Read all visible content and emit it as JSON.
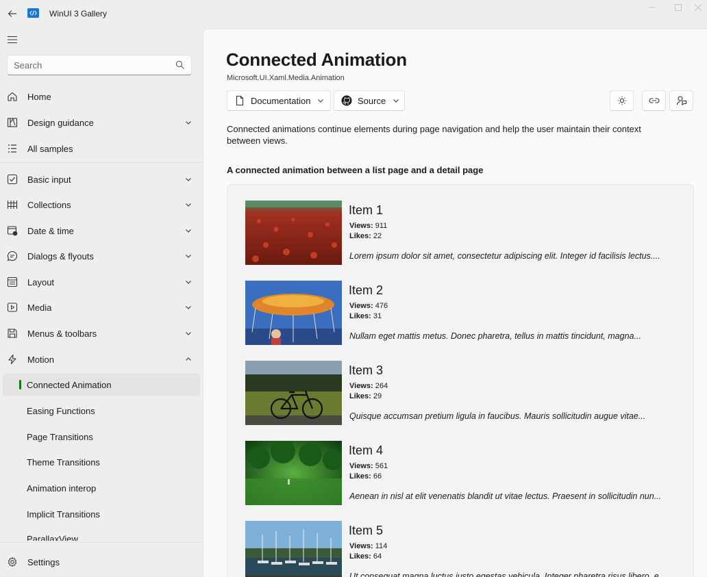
{
  "window": {
    "title": "WinUI 3 Gallery"
  },
  "search": {
    "placeholder": "Search"
  },
  "nav": {
    "top_items": [
      {
        "label": "Home",
        "icon": "home-icon"
      },
      {
        "label": "Design guidance",
        "icon": "design-guidance-icon"
      },
      {
        "label": "All samples",
        "icon": "list-icon"
      }
    ],
    "categories": [
      {
        "label": "Basic input",
        "icon": "checkbox-icon"
      },
      {
        "label": "Collections",
        "icon": "grid-icon"
      },
      {
        "label": "Date & time",
        "icon": "calendar-clock-icon"
      },
      {
        "label": "Dialogs & flyouts",
        "icon": "chat-icon"
      },
      {
        "label": "Layout",
        "icon": "layout-icon"
      },
      {
        "label": "Media",
        "icon": "media-icon"
      },
      {
        "label": "Menus & toolbars",
        "icon": "save-icon"
      },
      {
        "label": "Motion",
        "icon": "motion-icon"
      }
    ],
    "motion_children": [
      {
        "label": "Connected Animation",
        "selected": true
      },
      {
        "label": "Easing Functions"
      },
      {
        "label": "Page Transitions"
      },
      {
        "label": "Theme Transitions"
      },
      {
        "label": "Animation interop"
      },
      {
        "label": "Implicit Transitions"
      },
      {
        "label": "ParallaxView"
      }
    ],
    "settings_label": "Settings",
    "accent_color": "#0f7b0f"
  },
  "page": {
    "title": "Connected Animation",
    "namespace": "Microsoft.UI.Xaml.Media.Animation",
    "documentation_label": "Documentation",
    "source_label": "Source",
    "description": "Connected animations continue elements during page navigation and help the user maintain their context between views.",
    "section_heading": "A connected animation between a list page and a detail page"
  },
  "items": [
    {
      "title": "Item 1",
      "views_label": "Views:",
      "views": "911",
      "likes_label": "Likes:",
      "likes": "22",
      "description": "Lorem ipsum dolor sit amet, consectetur adipiscing elit. Integer id facilisis lectus....",
      "thumb": "red-flower-field"
    },
    {
      "title": "Item 2",
      "views_label": "Views:",
      "views": "476",
      "likes_label": "Likes:",
      "likes": "31",
      "description": "Nullam eget mattis metus. Donec pharetra, tellus in mattis tincidunt, magna...",
      "thumb": "carnival-swing-ride"
    },
    {
      "title": "Item 3",
      "views_label": "Views:",
      "views": "264",
      "likes_label": "Likes:",
      "likes": "29",
      "description": "Quisque accumsan pretium ligula in faucibus. Mauris sollicitudin augue vitae...",
      "thumb": "bicycle-in-field"
    },
    {
      "title": "Item 4",
      "views_label": "Views:",
      "views": "561",
      "likes_label": "Likes:",
      "likes": "66",
      "description": "Aenean in nisl at elit venenatis blandit ut vitae lectus. Praesent in sollicitudin nun...",
      "thumb": "green-forest-clearing"
    },
    {
      "title": "Item 5",
      "views_label": "Views:",
      "views": "114",
      "likes_label": "Likes:",
      "likes": "64",
      "description": "Ut consequat magna luctus justo egestas vehicula. Integer pharetra risus libero, e...",
      "thumb": "harbor-sailboats"
    }
  ]
}
